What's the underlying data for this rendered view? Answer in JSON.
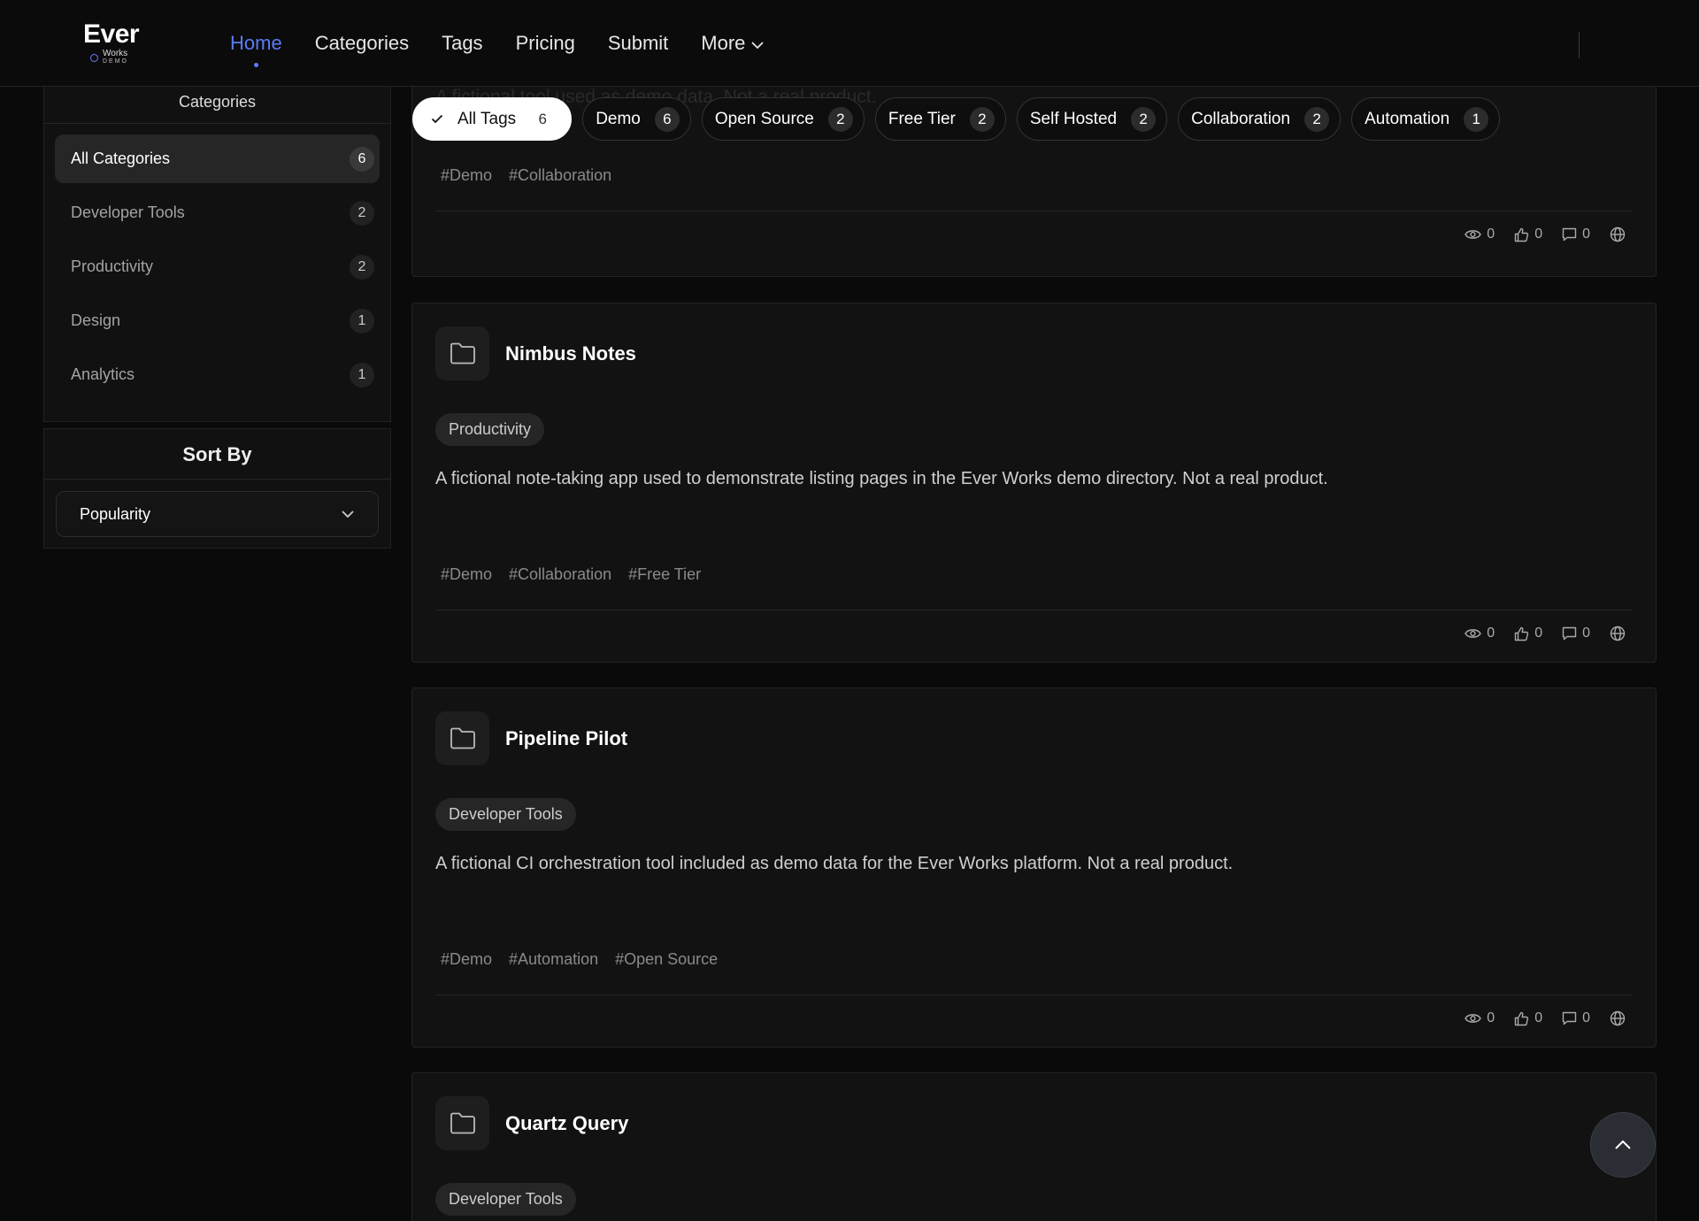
{
  "logo": {
    "ever": "Ever",
    "works": "Works",
    "demo": "DEMO"
  },
  "nav": {
    "home": "Home",
    "categories": "Categories",
    "tags": "Tags",
    "pricing": "Pricing",
    "submit": "Submit",
    "more": "More"
  },
  "sidebar": {
    "categories_title": "Categories",
    "categories": [
      {
        "name": "All Categories",
        "count": "6"
      },
      {
        "name": "Developer Tools",
        "count": "2"
      },
      {
        "name": "Productivity",
        "count": "2"
      },
      {
        "name": "Design",
        "count": "1"
      },
      {
        "name": "Analytics",
        "count": "1"
      }
    ],
    "sort_title": "Sort By",
    "sort_value": "Popularity"
  },
  "tags": [
    {
      "label": "All Tags",
      "count": "6"
    },
    {
      "label": "Demo",
      "count": "6"
    },
    {
      "label": "Open Source",
      "count": "2"
    },
    {
      "label": "Free Tier",
      "count": "2"
    },
    {
      "label": "Self Hosted",
      "count": "2"
    },
    {
      "label": "Collaboration",
      "count": "2"
    },
    {
      "label": "Automation",
      "count": "1"
    }
  ],
  "cards": [
    {
      "desc_partial": "A fictional tool used as demo data. Not a real product.",
      "tags": [
        "#Demo",
        "#Collaboration"
      ],
      "views": "0",
      "likes": "0",
      "comments": "0"
    },
    {
      "title": "Nimbus Notes",
      "category": "Productivity",
      "description": "A fictional note-taking app used to demonstrate listing pages in the Ever Works demo directory. Not a real product.",
      "tags": [
        "#Demo",
        "#Collaboration",
        "#Free Tier"
      ],
      "views": "0",
      "likes": "0",
      "comments": "0"
    },
    {
      "title": "Pipeline Pilot",
      "category": "Developer Tools",
      "description": "A fictional CI orchestration tool included as demo data for the Ever Works platform. Not a real product.",
      "tags": [
        "#Demo",
        "#Automation",
        "#Open Source"
      ],
      "views": "0",
      "likes": "0",
      "comments": "0"
    },
    {
      "title": "Quartz Query",
      "category": "Developer Tools"
    }
  ],
  "colors": {
    "accent": "#5b7cfa",
    "background": "#0a0a0a",
    "card": "#121212"
  }
}
